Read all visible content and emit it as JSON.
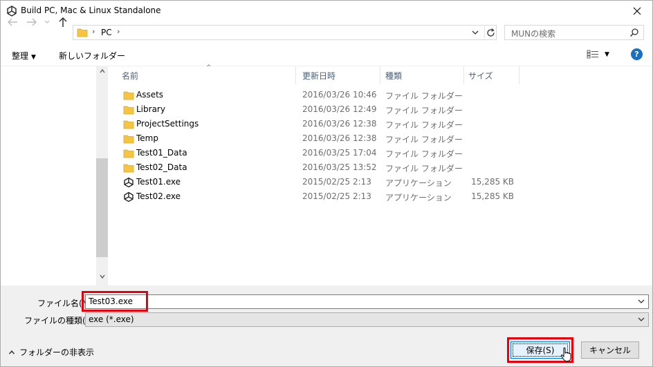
{
  "window": {
    "title": "Build PC, Mac & Linux Standalone",
    "app_icon": "unity-icon",
    "close_icon": "close-icon"
  },
  "address": {
    "breadcrumb": [
      "PC"
    ],
    "separator": "›",
    "search_placeholder": "MUNの検索"
  },
  "toolbar": {
    "organize_label": "整理",
    "new_folder_label": "新しいフォルダー",
    "help_label": "?"
  },
  "file_list": {
    "columns": [
      "名前",
      "更新日時",
      "種類",
      "サイズ"
    ],
    "rows": [
      {
        "name": "Assets",
        "date": "2016/03/26 10:46",
        "type": "ファイル フォルダー",
        "size": "",
        "icon": "folder-icon"
      },
      {
        "name": "Library",
        "date": "2016/03/26 12:49",
        "type": "ファイル フォルダー",
        "size": "",
        "icon": "folder-icon"
      },
      {
        "name": "ProjectSettings",
        "date": "2016/03/26 12:38",
        "type": "ファイル フォルダー",
        "size": "",
        "icon": "folder-icon"
      },
      {
        "name": "Temp",
        "date": "2016/03/26 12:38",
        "type": "ファイル フォルダー",
        "size": "",
        "icon": "folder-icon"
      },
      {
        "name": "Test01_Data",
        "date": "2016/03/25 17:04",
        "type": "ファイル フォルダー",
        "size": "",
        "icon": "folder-icon"
      },
      {
        "name": "Test02_Data",
        "date": "2016/03/25 13:52",
        "type": "ファイル フォルダー",
        "size": "",
        "icon": "folder-icon"
      },
      {
        "name": "Test01.exe",
        "date": "2015/02/25 2:13",
        "type": "アプリケーション",
        "size": "15,285 KB",
        "icon": "unity-exe-icon"
      },
      {
        "name": "Test02.exe",
        "date": "2015/02/25 2:13",
        "type": "アプリケーション",
        "size": "15,285 KB",
        "icon": "unity-exe-icon"
      }
    ]
  },
  "form": {
    "filename_label": "ファイル名(N):",
    "filename_value": "Test03.exe",
    "filetype_label": "ファイルの種類(T):",
    "filetype_value": "exe (*.exe)"
  },
  "footer": {
    "hide_folders_label": "フォルダーの非表示",
    "save_label": "保存(S)",
    "cancel_label": "キャンセル"
  },
  "colors": {
    "highlight": "#e8000c",
    "accent": "#0078d7",
    "folder": "#f5c542"
  }
}
